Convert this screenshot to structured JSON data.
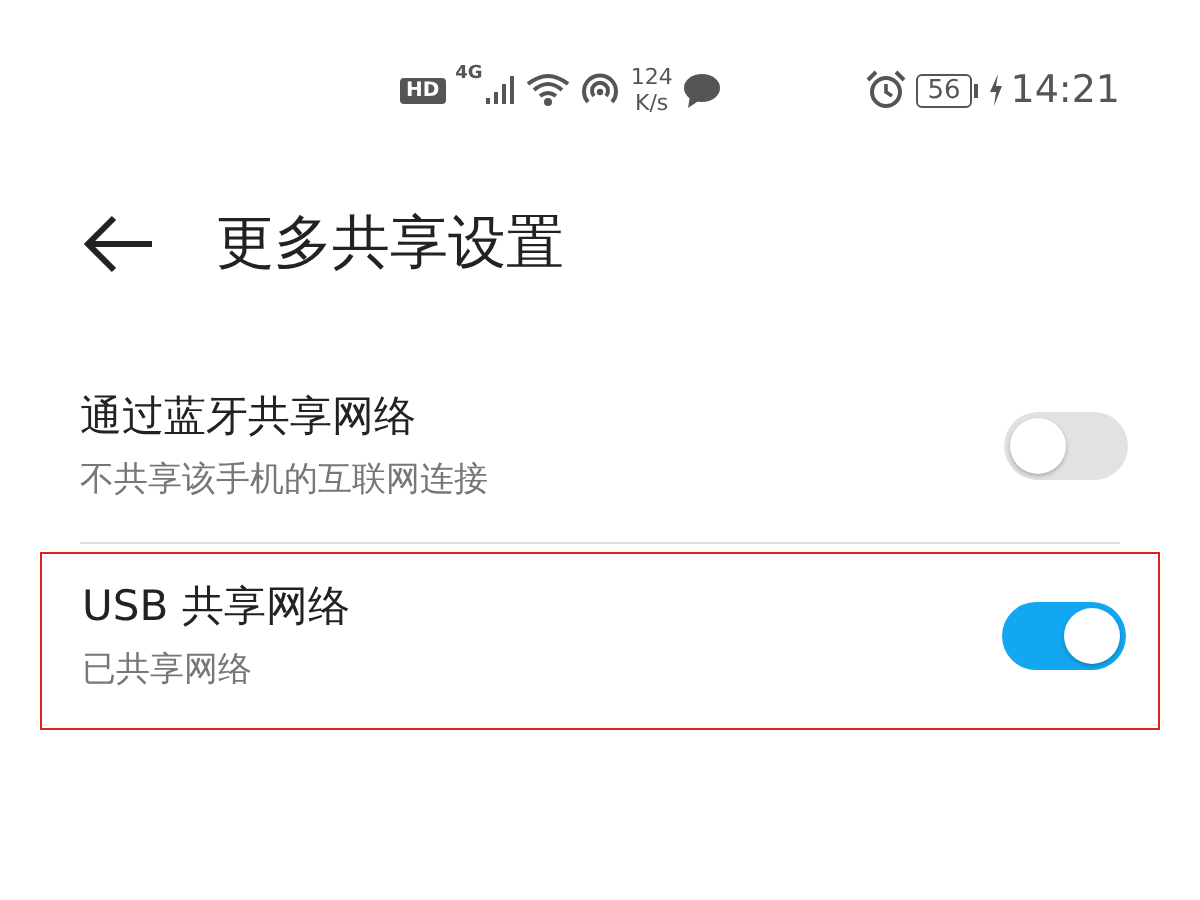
{
  "status_bar": {
    "hd": "HD",
    "network": "4G",
    "speed": "124",
    "speed_unit": "K/s",
    "battery": "56",
    "charging": true,
    "time": "14:21"
  },
  "header": {
    "title": "更多共享设置"
  },
  "settings": [
    {
      "title": "通过蓝牙共享网络",
      "subtitle": "不共享该手机的互联网连接",
      "on": false,
      "highlighted": false
    },
    {
      "title": "USB 共享网络",
      "subtitle": "已共享网络",
      "on": true,
      "highlighted": true
    }
  ]
}
